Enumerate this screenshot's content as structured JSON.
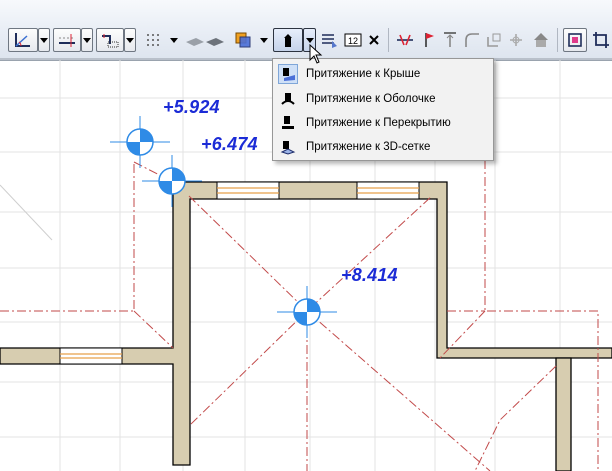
{
  "toolbar": {
    "buttons": [
      {
        "icon": "angle-snap-icon"
      },
      {
        "icon": "dropdown-arrow-icon"
      },
      {
        "icon": "guideline-icon"
      },
      {
        "icon": "dropdown-arrow-icon"
      },
      {
        "icon": "snap-points-icon"
      },
      {
        "icon": "dropdown-arrow-icon"
      },
      {
        "icon": "grid-dots-icon"
      },
      {
        "icon": "dropdown-arrow-icon"
      },
      {
        "icon": "plane-icon"
      },
      {
        "icon": "layer-color-icon"
      },
      {
        "icon": "dropdown-arrow-icon"
      },
      {
        "icon": "gravity-roof-icon"
      },
      {
        "icon": "dropdown-arrow-icon"
      },
      {
        "icon": "sun-snap-icon"
      },
      {
        "icon": "measure-icon"
      },
      {
        "icon": "close-icon"
      },
      {
        "icon": "trim-icon"
      },
      {
        "icon": "marker-icon"
      },
      {
        "icon": "align-top-icon"
      },
      {
        "icon": "fillet-icon"
      },
      {
        "icon": "offset-icon"
      },
      {
        "icon": "house-icon"
      },
      {
        "icon": "select-frame-icon"
      },
      {
        "icon": "crop-icon"
      }
    ]
  },
  "gravity_menu": {
    "items": [
      {
        "label": "Притяжение к Крыше",
        "icon": "gravity-roof-icon",
        "selected": true
      },
      {
        "label": "Притяжение к Оболочке",
        "icon": "gravity-shell-icon",
        "selected": false
      },
      {
        "label": "Притяжение к Перекрытию",
        "icon": "gravity-slab-icon",
        "selected": false
      },
      {
        "label": "Притяжение к 3D-сетке",
        "icon": "gravity-mesh-icon",
        "selected": false
      }
    ]
  },
  "plan": {
    "elevations": [
      "+5.924",
      "+6.474",
      "+8.414"
    ],
    "colors": {
      "elevation_text": "#1b2bd6",
      "marker": "#2f8be6",
      "wall_fill": "#d7cdb0",
      "roof_line": "#c24a4a",
      "grid": "#e3e3e3"
    }
  }
}
